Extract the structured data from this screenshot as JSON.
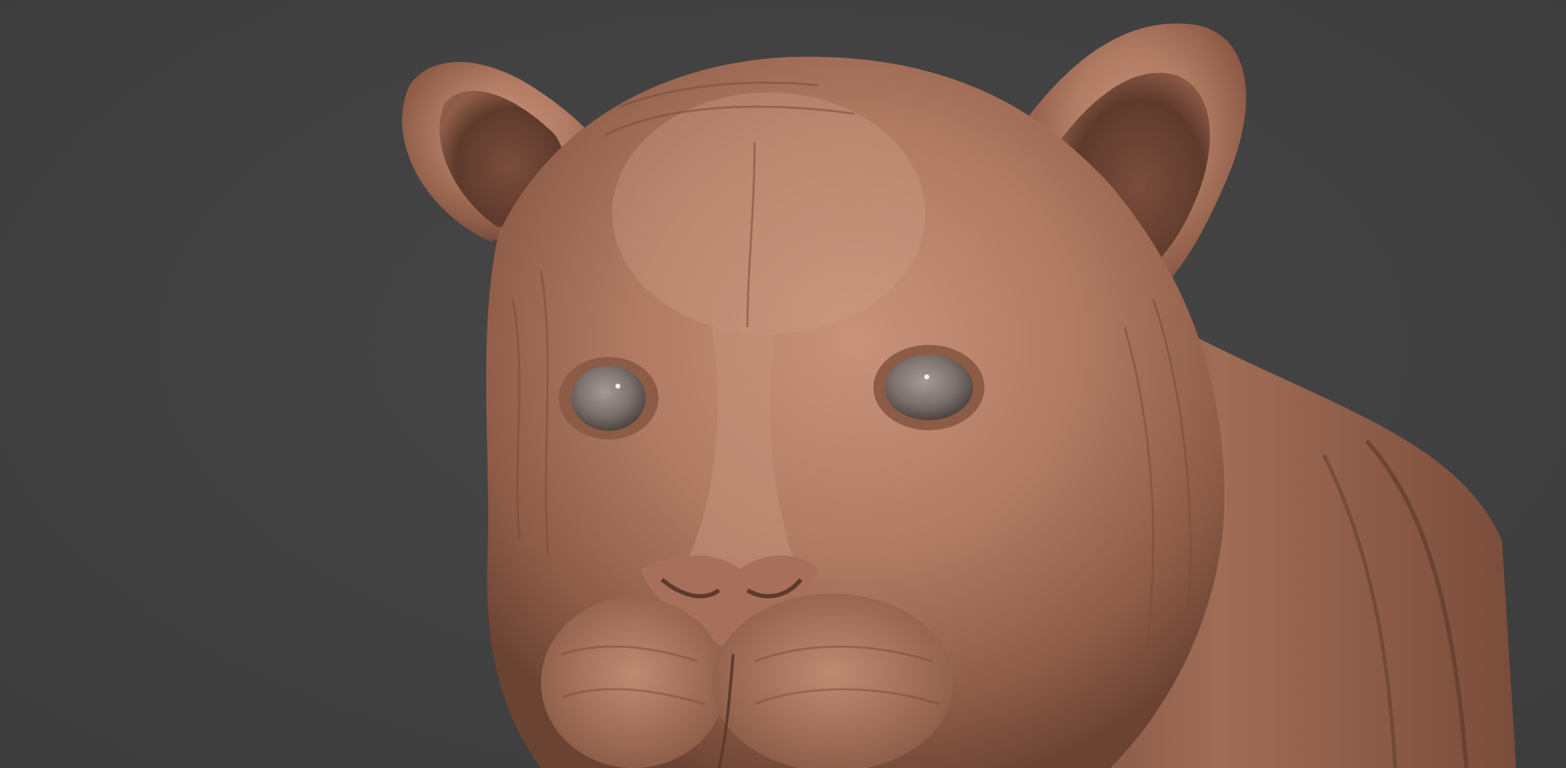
{
  "image": {
    "subject": "",
    "background_color": "#424242",
    "material_color": "#b27c64",
    "eye_color": "#8a7f7b"
  }
}
